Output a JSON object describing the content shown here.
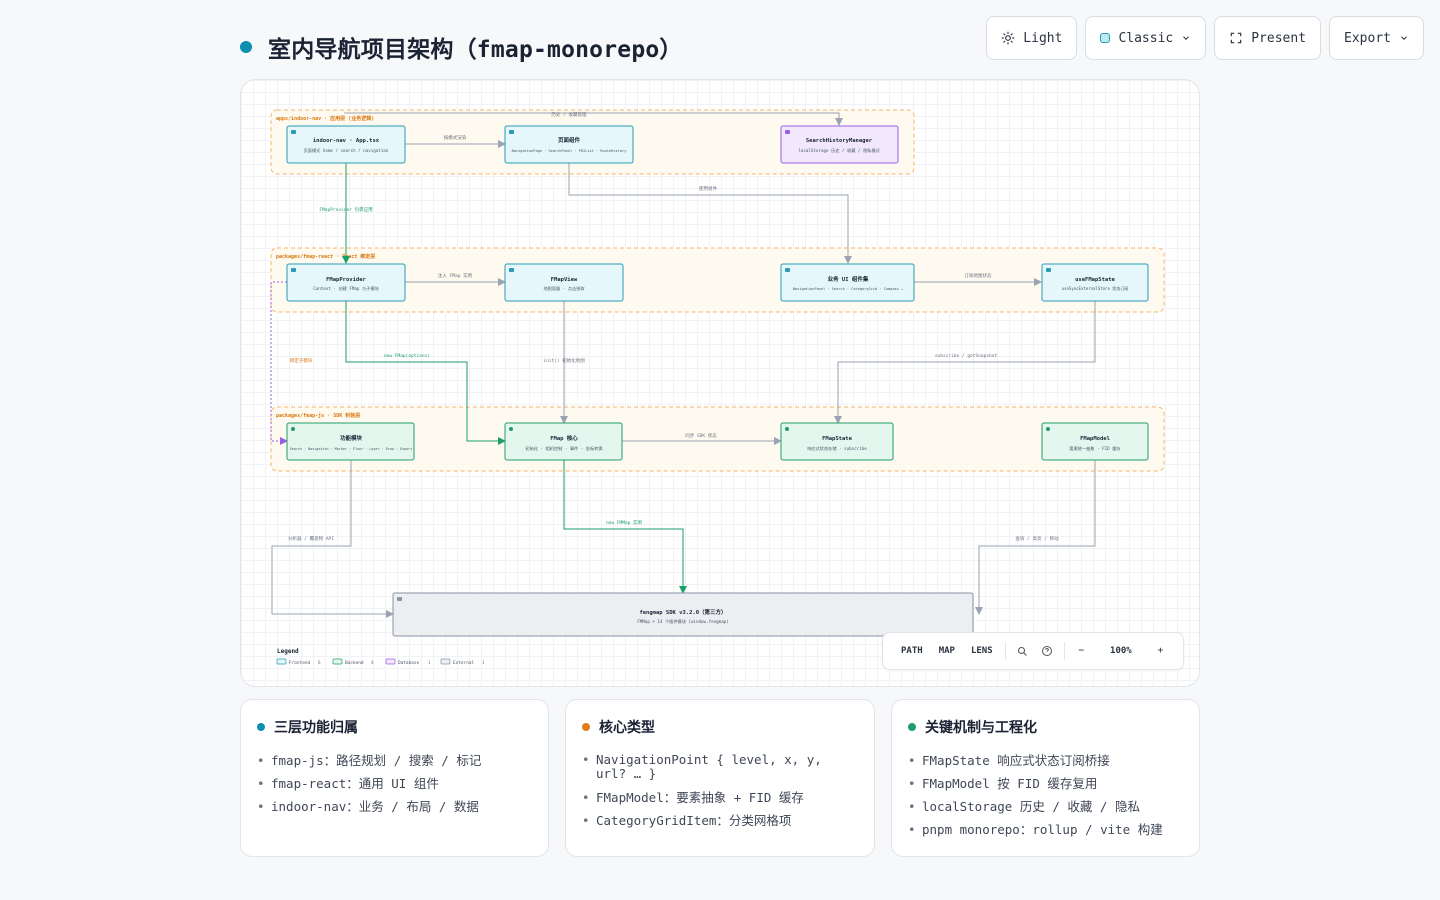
{
  "page": {
    "title": "室内导航项目架构（fmap-monorepo）",
    "title_dot_color": "#0e8fb0"
  },
  "toolbar": {
    "light_label": "Light",
    "theme_label": "Classic",
    "present_label": "Present",
    "export_label": "Export"
  },
  "diagram": {
    "groups": {
      "apps": "apps/indoor-nav · 应用层 (业务逻辑)",
      "react": "packages/fmap-react · React 绑定层",
      "js": "packages/fmap-js · SDK 封装层"
    },
    "nodes": {
      "app": {
        "title": "indoor-nav · App.tsx",
        "sub": "页面模式 home / search / navigation"
      },
      "pages": {
        "title": "页面组件",
        "sub": "NavigationPage · SearchPanel · POIList · RouteHistory"
      },
      "history": {
        "title": "SearchHistoryManager",
        "sub": "localStorage 历史 / 收藏 / 隐私模式"
      },
      "provider": {
        "title": "FMapProvider",
        "sub": "Context · 创建 FMap 与子模块"
      },
      "mapview": {
        "title": "FMapView",
        "sub": "地图容器 · 点击拾取"
      },
      "bizui": {
        "title": "业务 UI 组件集",
        "sub": "NavigationPanel · Search · CategoryGrid · Compass …"
      },
      "usestate": {
        "title": "useFMapState",
        "sub": "useSyncExternalStore 状态订阅"
      },
      "modules": {
        "title": "功能模块",
        "sub": "Search · Navigation · Marker · Floor · Layer · Draw · Export"
      },
      "core": {
        "title": "FMap 核心",
        "sub": "初始化 · 相机控制 · 事件 · 坐标转换"
      },
      "state": {
        "title": "FMapState",
        "sub": "响应式状态存储 · subscribe"
      },
      "model": {
        "title": "FMapModel",
        "sub": "要素统一抽象 · FID 缓存"
      },
      "sdk": {
        "title": "fengmap SDK v3.2.0（第三方）",
        "sub": "FMMap + 14 个插件模块 (window.fengmap)"
      }
    },
    "edges": {
      "e_history": "历史 / 收藏管理",
      "e_mode": "按模式渲染",
      "e_provider": "FMapProvider 包裹应用",
      "e_use_comp": "使用组件",
      "e_inject": "注入 FMap 实例",
      "e_subscribe_state": "订阅地图状态",
      "e_new": "new FMap(options)",
      "e_init": "init() 初始化地图",
      "e_subscribe": "subscribe / getSnapshot",
      "e_bind": "绑定子模块",
      "e_sync": "同步 SDK 状态",
      "e_new_sdk": "new FMMap 实例",
      "e_api": "分析器 / 覆盖物 API",
      "e_feature": "查询 / 高亮 / 移动"
    },
    "legend": {
      "title": "Legend",
      "items": [
        {
          "label": "Frontend",
          "count": "6",
          "fill": "#e5f7fb",
          "stroke": "#2a9bb6"
        },
        {
          "label": "Backend",
          "count": "4",
          "fill": "#e4f7ef",
          "stroke": "#1e9e6a"
        },
        {
          "label": "Database",
          "count": "1",
          "fill": "#f1e8fc",
          "stroke": "#9b5de5"
        },
        {
          "label": "External",
          "count": "1",
          "fill": "#eceef2",
          "stroke": "#8a93a3"
        }
      ]
    }
  },
  "zoombar": {
    "tabs": [
      "PATH",
      "MAP",
      "LENS"
    ],
    "zoom_level": "100%",
    "minus": "−",
    "plus": "+"
  },
  "cards": [
    {
      "title": "三层功能归属",
      "dot_color": "#0e8fb0",
      "items": [
        "fmap-js：路径规划 / 搜索 / 标记",
        "fmap-react：通用 UI 组件",
        "indoor-nav：业务 / 布局 / 数据"
      ]
    },
    {
      "title": "核心类型",
      "dot_color": "#e07b1a",
      "items": [
        "NavigationPoint { level, x, y, url? … }",
        "FMapModel：要素抽象 + FID 缓存",
        "CategoryGridItem：分类网格项"
      ]
    },
    {
      "title": "关键机制与工程化",
      "dot_color": "#1e9e6a",
      "items": [
        "FMapState 响应式状态订阅桥接",
        "FMapModel 按 FID 缓存复用",
        "localStorage 历史 / 收藏 / 隐私",
        "pnpm monorepo：rollup / vite 构建"
      ]
    }
  ]
}
